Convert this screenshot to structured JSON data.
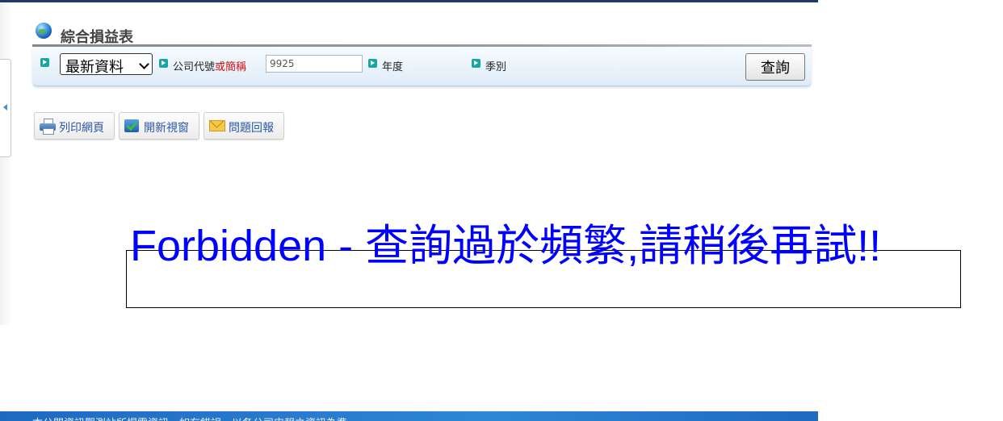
{
  "page": {
    "title": "綜合損益表"
  },
  "query_bar": {
    "period_select_value": "最新資料",
    "company_label": "公司代號",
    "company_label_or_name": "或簡稱",
    "company_input_value": "9925",
    "year_label": "年度",
    "season_label": "季別",
    "submit_label": "查詢"
  },
  "toolbar": {
    "print_label": "列印網頁",
    "new_window_label": "開新視窗",
    "report_label": "問題回報"
  },
  "error": {
    "message": "Forbidden - 查詢過於頻繁,請稍後再試!!"
  },
  "footer": {
    "text": "本公開資訊觀測站所揭露資訊，如有錯誤，以各公司申報之資訊為準。"
  },
  "colors": {
    "error_text": "#0000ff",
    "label_highlight": "#d01010",
    "footer_bg": "#2f86d6",
    "top_bar": "#1e3a66"
  }
}
